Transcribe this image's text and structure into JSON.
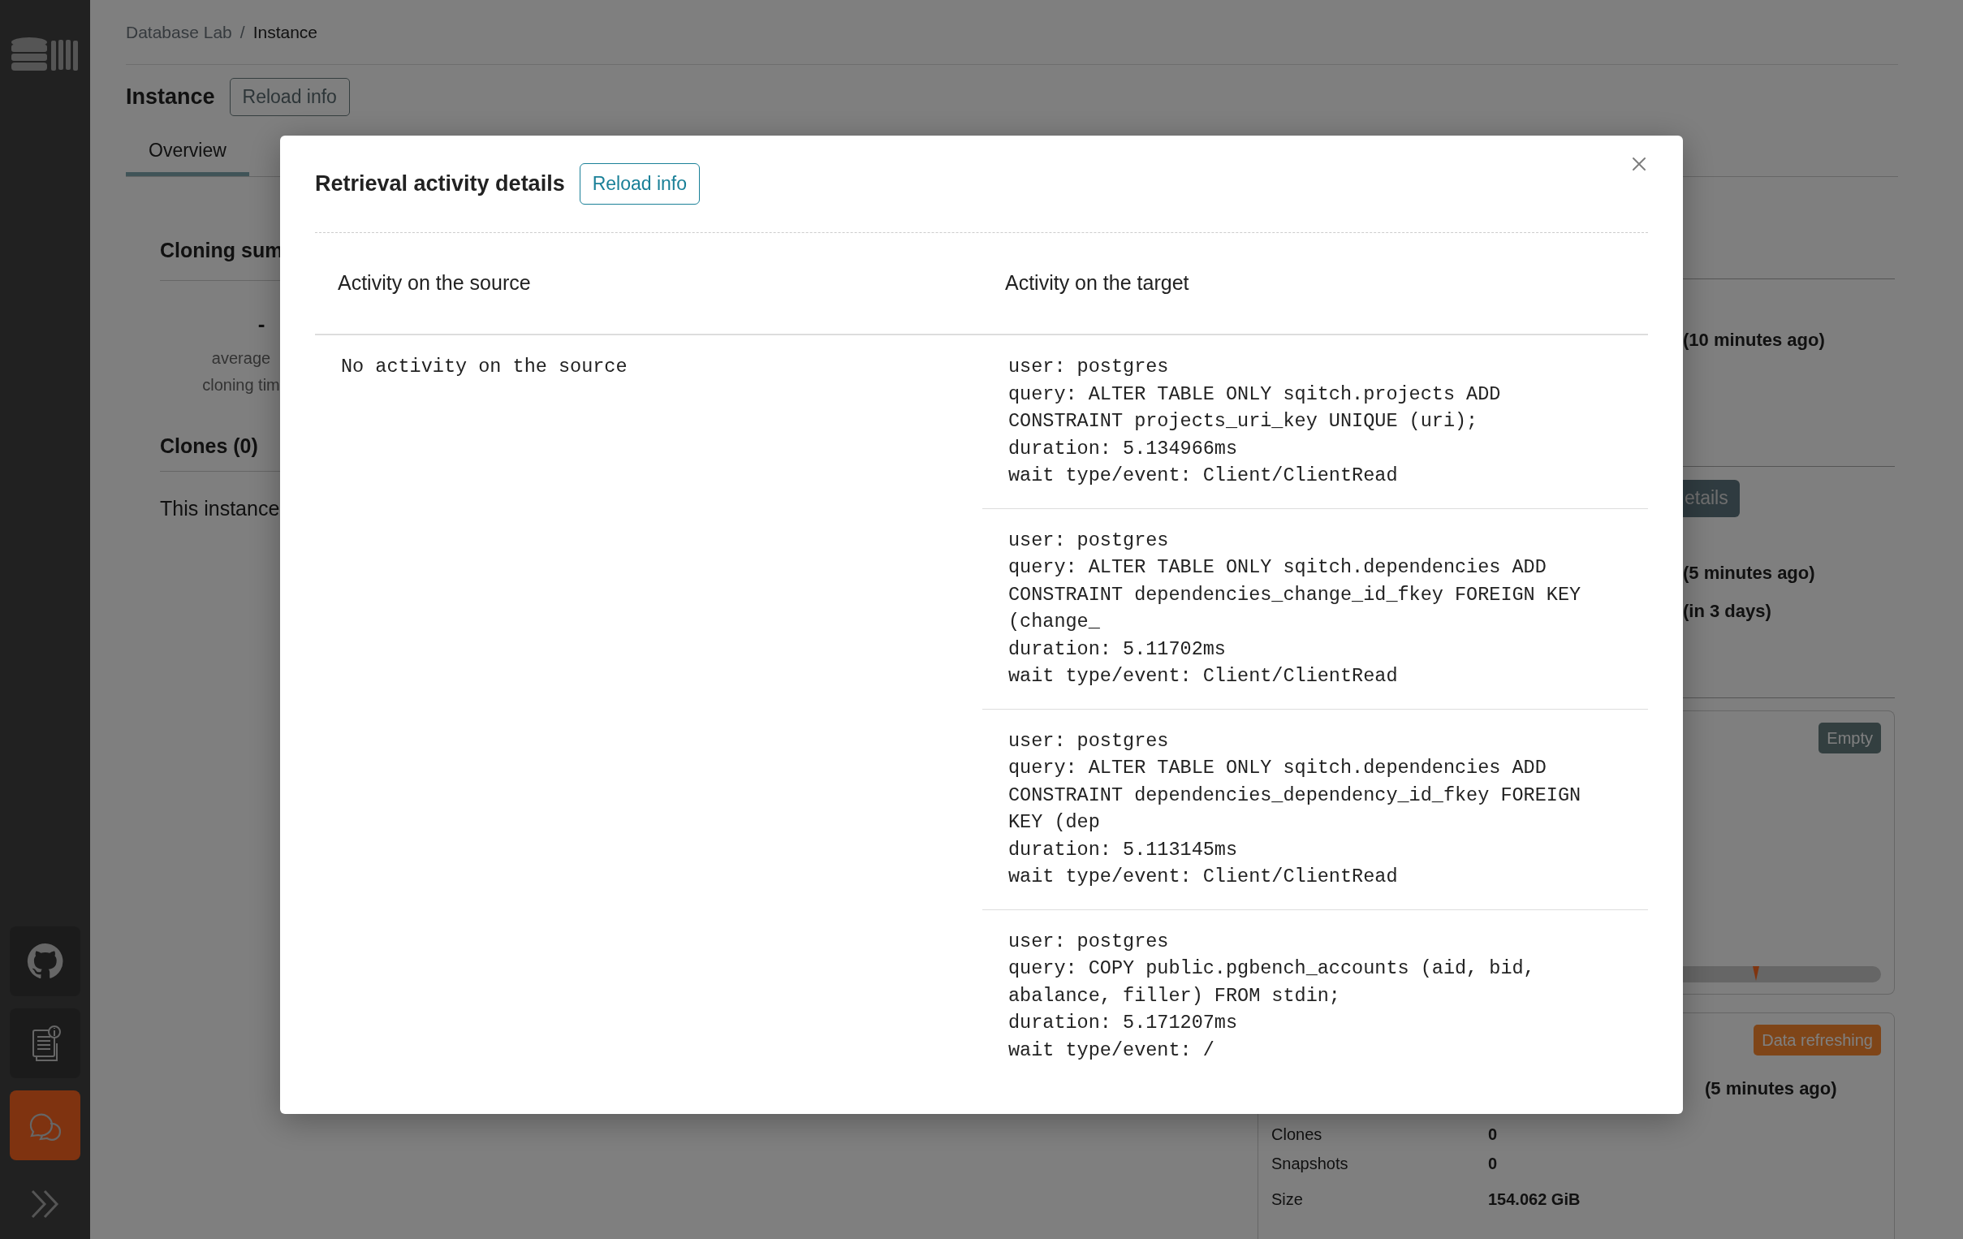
{
  "sidebar": {
    "items": [
      {
        "kind": "github",
        "selected": false
      },
      {
        "kind": "docs",
        "selected": false
      },
      {
        "kind": "chat",
        "selected": true
      }
    ]
  },
  "breadcrumb": {
    "items": [
      "Database Lab",
      "Instance"
    ],
    "separator": "/"
  },
  "page": {
    "title": "Instance",
    "reload_button": "Reload info"
  },
  "tabs": [
    {
      "label": "Overview",
      "selected": true
    }
  ],
  "summary": {
    "title": "Cloning sum",
    "stat_value": "-",
    "stat_label": "average cloning tim"
  },
  "clones": {
    "title": "Clones (0)",
    "message": "This instance"
  },
  "right_panel": {
    "last_refresh": "(10 minutes ago)",
    "details_button": "etails",
    "refresh_times": [
      "(5 minutes ago)",
      "(in 3 days)"
    ]
  },
  "disk_card": {
    "badge": "Empty"
  },
  "snapshot_card": {
    "badge": "Data refreshing",
    "started": "(5 minutes ago)",
    "rows": [
      {
        "label": "Clones",
        "value": "0"
      },
      {
        "label": "Snapshots",
        "value": "0"
      },
      {
        "label": "Size",
        "value": "154.062 GiB"
      }
    ]
  },
  "modal": {
    "title": "Retrieval activity details",
    "reload_button": "Reload info",
    "columns": [
      "Activity on the source",
      "Activity on the target"
    ],
    "source": [
      "No activity on the source"
    ],
    "target": [
      {
        "lines": [
          "user: postgres",
          "query: ALTER TABLE ONLY sqitch.projects ADD CONSTRAINT projects_uri_key UNIQUE (uri);",
          "duration: 5.134966ms",
          "wait type/event: Client/ClientRead"
        ]
      },
      {
        "lines": [
          "user: postgres",
          "query: ALTER TABLE ONLY sqitch.dependencies ADD CONSTRAINT dependencies_change_id_fkey FOREIGN KEY (change_",
          "duration: 5.11702ms",
          "wait type/event: Client/ClientRead"
        ]
      },
      {
        "lines": [
          "user: postgres",
          "query: ALTER TABLE ONLY sqitch.dependencies ADD CONSTRAINT dependencies_dependency_id_fkey FOREIGN KEY (dep",
          "duration: 5.113145ms",
          "wait type/event: Client/ClientRead"
        ]
      },
      {
        "lines": [
          "user: postgres",
          "query: COPY public.pgbench_accounts (aid, bid, abalance, filler) FROM stdin;",
          "duration: 5.171207ms",
          "wait type/event: /"
        ]
      }
    ]
  }
}
